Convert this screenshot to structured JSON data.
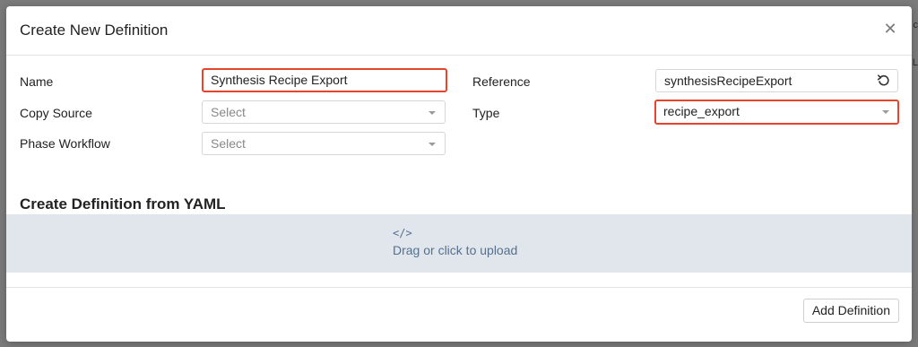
{
  "modal": {
    "title": "Create New Definition",
    "close_icon": "close-icon"
  },
  "backdrop": {
    "text_1": "c",
    "text_2": "IL"
  },
  "form": {
    "name": {
      "label": "Name",
      "value": "Synthesis Recipe Export",
      "highlighted": true
    },
    "copy_source": {
      "label": "Copy Source",
      "placeholder": "Select"
    },
    "phase_workflow": {
      "label": "Phase Workflow",
      "placeholder": "Select"
    },
    "reference": {
      "label": "Reference",
      "value": "synthesisRecipeExport",
      "icon": "refresh-icon"
    },
    "type": {
      "label": "Type",
      "value": "recipe_export",
      "highlighted": true
    }
  },
  "yaml_section": {
    "title": "Create Definition from YAML",
    "icon_glyph": "</>",
    "upload_text": "Drag or click to upload"
  },
  "footer": {
    "add_button_label": "Add Definition"
  },
  "colors": {
    "highlight_border": "#e5452b",
    "upload_bg": "#e1e6ec",
    "upload_text": "#55708e",
    "backdrop": "#7b7b7b"
  }
}
